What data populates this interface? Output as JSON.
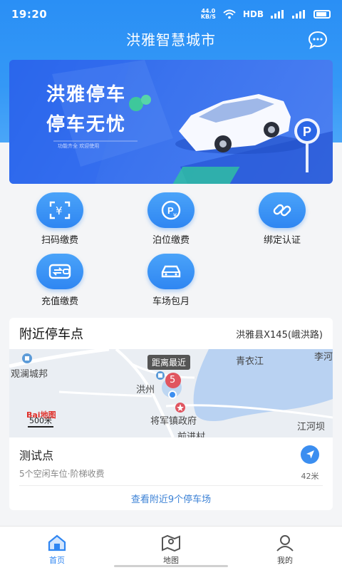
{
  "status": {
    "time": "19:20",
    "speed_value": "44.0",
    "speed_unit": "KB/S",
    "network": "HDB"
  },
  "header": {
    "title": "洪雅智慧城市"
  },
  "banner": {
    "line1": "洪雅停车",
    "line2": "停车无忧",
    "small_text": "功能齐全 欢迎使用"
  },
  "menu": [
    {
      "label": "扫码缴费",
      "icon": "scan-pay-icon"
    },
    {
      "label": "泊位缴费",
      "icon": "parking-pay-icon"
    },
    {
      "label": "绑定认证",
      "icon": "link-icon"
    },
    {
      "label": "充值缴费",
      "icon": "wallet-icon"
    },
    {
      "label": "车场包月",
      "icon": "car-icon"
    }
  ],
  "nearby": {
    "title": "附近停车点",
    "address": "洪雅县X145(峨洪路)",
    "map": {
      "labels": [
        "观澜城邦",
        "青衣江",
        "李河",
        "洪州",
        "将军镇政府",
        "前进村",
        "江河坝"
      ],
      "nearest_tag": "距离最近",
      "marker_count": "5",
      "scale": "500米",
      "logo": "Bai地图"
    },
    "spot": {
      "name": "测试点",
      "desc": "5个空闲车位·阶梯收费",
      "distance": "42米"
    },
    "more": "查看附近9个停车场"
  },
  "tabs": [
    {
      "label": "首页",
      "active": true
    },
    {
      "label": "地图",
      "active": false
    },
    {
      "label": "我的",
      "active": false
    }
  ],
  "colors": {
    "primary": "#2f86f2",
    "link": "#3c82d6",
    "marker": "#e05560"
  }
}
